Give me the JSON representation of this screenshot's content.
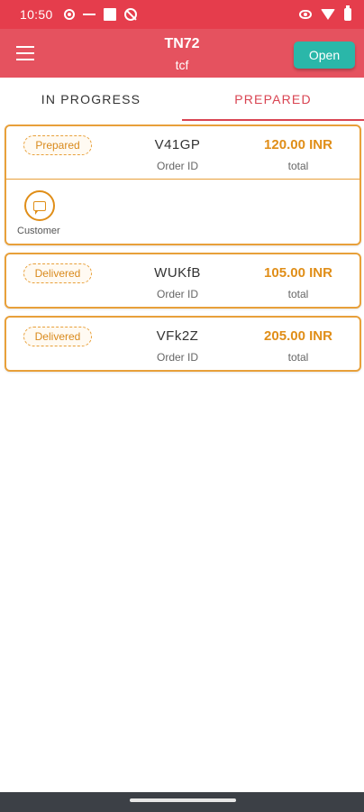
{
  "status_bar": {
    "time": "10:50",
    "icons_left": [
      "location-icon",
      "dashes-icon",
      "square-icon",
      "no-sign-icon"
    ],
    "icons_right": [
      "eye-icon",
      "wifi-icon",
      "battery-icon"
    ]
  },
  "app_bar": {
    "title": "TN72",
    "subtitle": "tcf",
    "open_button": "Open"
  },
  "tabs": [
    {
      "label": "IN PROGRESS",
      "active": false
    },
    {
      "label": "PREPARED",
      "active": true
    }
  ],
  "orders": [
    {
      "status": "Prepared",
      "id": "V41GP",
      "id_label": "Order ID",
      "amount": "120.00 INR",
      "amount_label": "total",
      "expanded": true,
      "customer_label": "Customer"
    },
    {
      "status": "Delivered",
      "id": "WUKfB",
      "id_label": "Order ID",
      "amount": "105.00 INR",
      "amount_label": "total",
      "expanded": false
    },
    {
      "status": "Delivered",
      "id": "VFk2Z",
      "id_label": "Order ID",
      "amount": "205.00 INR",
      "amount_label": "total",
      "expanded": false
    }
  ],
  "colors": {
    "status_bar": "#e53d4c",
    "app_bar": "#e5525f",
    "accent": "#e8a03a",
    "open_button": "#2ab7a9",
    "active_tab": "#d94452"
  }
}
